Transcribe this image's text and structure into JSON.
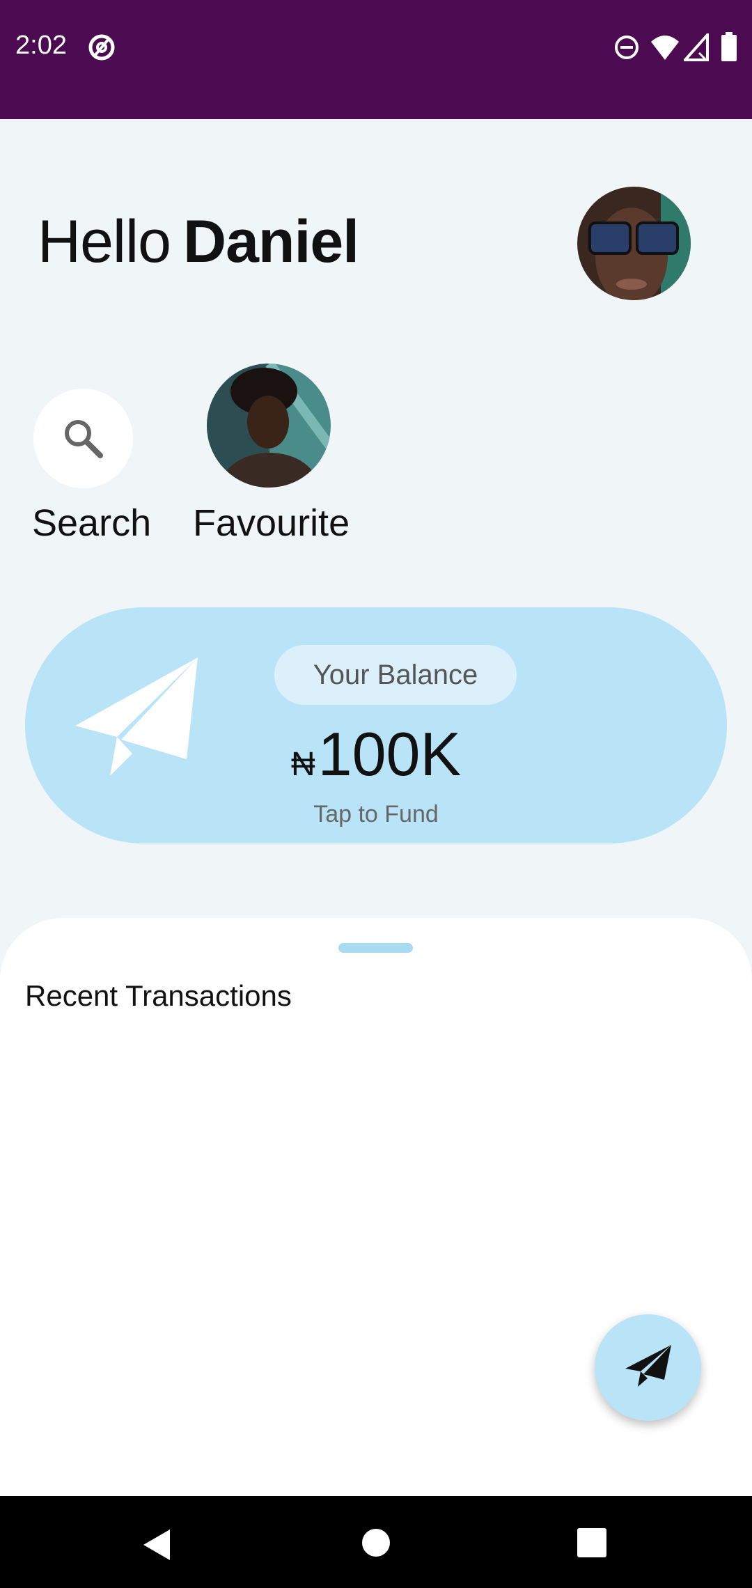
{
  "status_bar": {
    "time": "2:02",
    "icons": [
      "at-sign-icon",
      "do-not-disturb-icon",
      "wifi-icon",
      "signal-icon",
      "battery-icon"
    ],
    "background": "#4c0b50"
  },
  "header": {
    "greeting": "Hello",
    "user_name": "Daniel",
    "avatar": "profile-photo"
  },
  "quick_actions": {
    "search_label": "Search",
    "favourite_label": "Favourite"
  },
  "balance_card": {
    "pill_label": "Your Balance",
    "currency_symbol": "₦",
    "amount": "100K",
    "tap_label": "Tap to Fund",
    "background": "#b9e4f8"
  },
  "transactions": {
    "title": "Recent Transactions"
  },
  "fab": {
    "icon": "send-icon"
  },
  "nav_bar": {
    "buttons": [
      "back-icon",
      "home-icon",
      "recents-icon"
    ]
  }
}
